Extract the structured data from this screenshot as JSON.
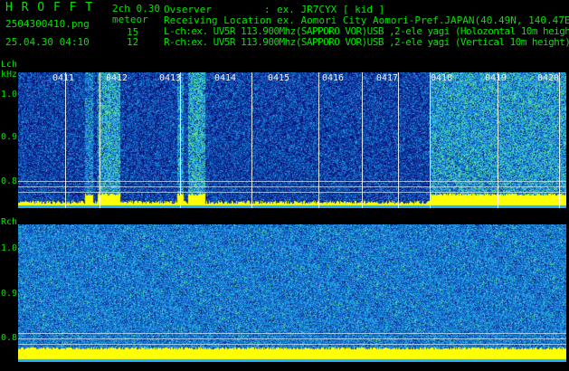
{
  "brand": "H R O F F T",
  "mode": "2ch 0.30",
  "meteor_label": "meteor",
  "filename": "2504300410.png",
  "datetime": "25.04.30 04:10",
  "count_l": "15",
  "count_r": "12",
  "observer": {
    "key": "Ovserver",
    "sep": ":",
    "value": "ex. JR7CYX [ kid ]"
  },
  "location": {
    "key": "Receiving Location",
    "sep": ":",
    "value": "ex. Aomori City Aomori-Pref.JAPAN(40.49N, 140.47E)"
  },
  "lch_info": "L-ch:ex. UV5R 113.900Mhz(SAPPORO VOR)USB ,2-ele yagi (Holozontal 10m height",
  "rch_info": "R-ch:ex. UV5R 113.900Mhz(SAPPORO VOR)USB ,2-ele yagi (Vertical 10m height)",
  "lch": {
    "label": "Lch",
    "unit": "kHz",
    "y_ticks": [
      "1.0",
      "0.9",
      "0.8"
    ]
  },
  "rch": {
    "label": "Rch",
    "y_ticks": [
      "1.0",
      "0.9",
      "0.8"
    ]
  },
  "time_marks": [
    "0411",
    "0412",
    "0413",
    "0414",
    "0415",
    "0416",
    "0417",
    "0418",
    "0419",
    "0420"
  ],
  "colors": {
    "text_green": "#00e400",
    "text_white": "#f0f0f0",
    "background": "#000000",
    "noise_dark": "#0a1f7a",
    "noise_light": "#1e6ad0",
    "signal": "#ffff00"
  }
}
